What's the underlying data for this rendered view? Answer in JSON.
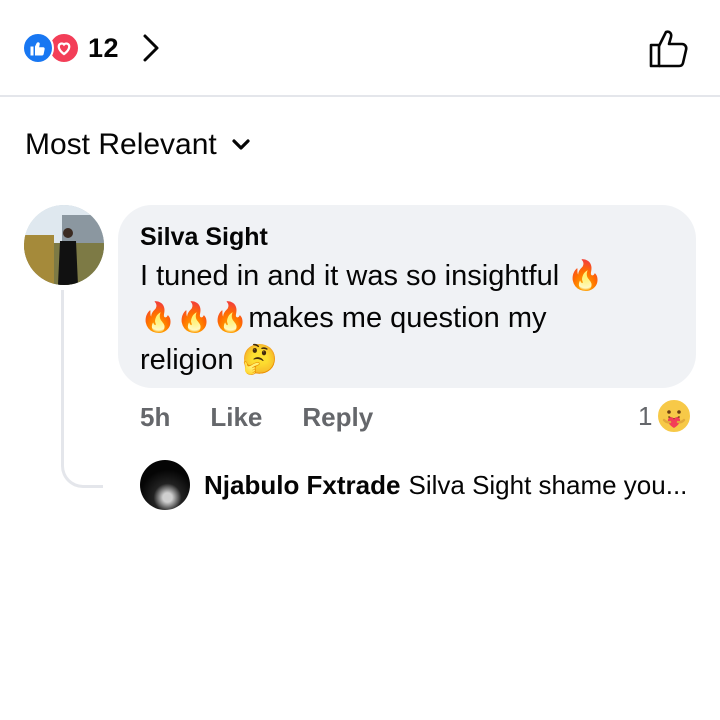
{
  "reactions": {
    "count": "12",
    "types": [
      "like",
      "love"
    ],
    "like_color": "#1877f2",
    "love_color": "#f33e58"
  },
  "sort": {
    "label": "Most Relevant"
  },
  "comment": {
    "author": "Silva Sight",
    "text_line1": "I tuned in and it was so insightful ",
    "emoji_fire": "🔥",
    "text_line2_emoji": "🔥🔥🔥",
    "text_line2": "makes me question my",
    "text_line3": "religion ",
    "emoji_thinking": "🤔",
    "timestamp": "5h",
    "like_label": "Like",
    "reply_label": "Reply",
    "reaction_count": "1",
    "reaction_type": "care"
  },
  "reply": {
    "author": "Njabulo Fxtrade",
    "text": "Silva Sight shame you..."
  },
  "colors": {
    "bubble_bg": "#f0f2f5",
    "secondary_text": "#65676b",
    "divider": "#e4e6eb"
  }
}
